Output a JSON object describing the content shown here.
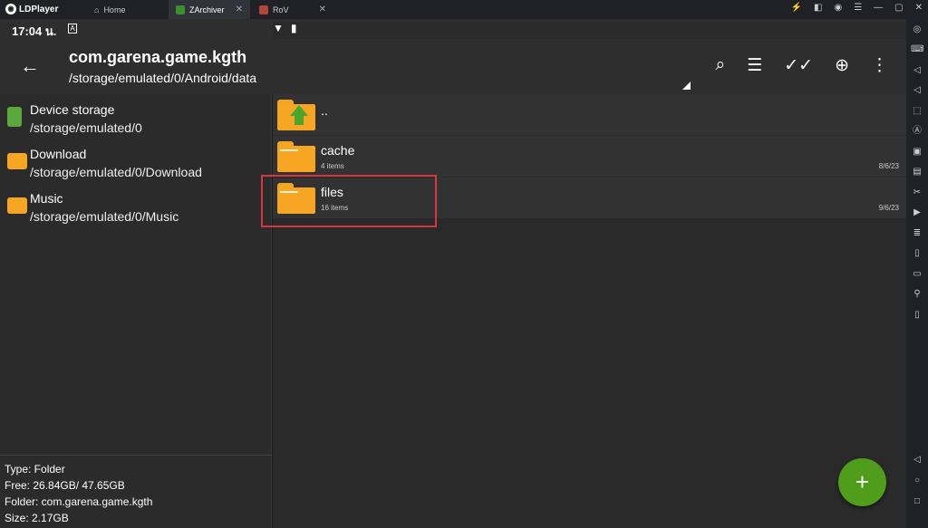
{
  "titlebar": {
    "brand": "LDPlayer",
    "tabs": [
      {
        "label": "Home",
        "icon": "home-icon"
      },
      {
        "label": "ZArchiver",
        "icon": "zarchiver-app-icon",
        "active": true
      },
      {
        "label": "RoV",
        "icon": "rov-game-icon"
      }
    ]
  },
  "statusbar": {
    "time": "17:04 น."
  },
  "appbar": {
    "title": "com.garena.game.kgth",
    "path": "/storage/emulated/0/Android/data"
  },
  "locations": [
    {
      "name": "Device storage",
      "path": "/storage/emulated/0",
      "icon": "device-storage-icon"
    },
    {
      "name": "Download",
      "path": "/storage/emulated/0/Download",
      "icon": "download-folder-icon"
    },
    {
      "name": "Music",
      "path": "/storage/emulated/0/Music",
      "icon": "music-folder-icon"
    }
  ],
  "info": {
    "type": "Type: Folder",
    "free": "Free: 26.84GB/ 47.65GB",
    "folder": "Folder: com.garena.game.kgth",
    "size": "Size: 2.17GB"
  },
  "files": [
    {
      "name": "..",
      "count": "",
      "date": ""
    },
    {
      "name": "cache",
      "count": "4 items",
      "date": "8/6/23"
    },
    {
      "name": "files",
      "count": "16 items",
      "date": "9/6/23"
    }
  ],
  "colors": {
    "folder": "#f6a623",
    "fab": "#4f9d1b",
    "highlight": "#d9363e"
  }
}
